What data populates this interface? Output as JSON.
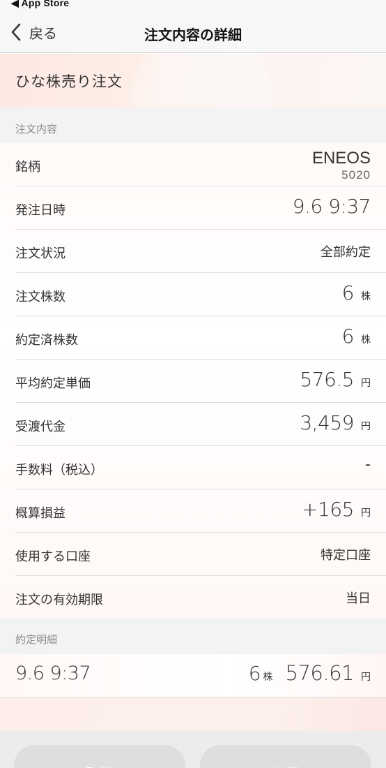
{
  "status_bar": {
    "back_label": "◀ App Store"
  },
  "nav": {
    "back_label": "戻る",
    "title": "注文内容の詳細"
  },
  "order_type": "ひな株売り注文",
  "sections": {
    "order_details": "注文内容",
    "executions": "約定明細"
  },
  "details": {
    "stock": {
      "label": "銘柄",
      "name": "ENEOS",
      "code": "5020"
    },
    "order_time": {
      "label": "発注日時",
      "value": "9.6 9:37"
    },
    "status": {
      "label": "注文状況",
      "value": "全部約定"
    },
    "quantity": {
      "label": "注文株数",
      "value": "6",
      "unit": "株"
    },
    "executed_quantity": {
      "label": "約定済株数",
      "value": "6",
      "unit": "株"
    },
    "avg_price": {
      "label": "平均約定単価",
      "value": "576.5",
      "unit": "円"
    },
    "settlement": {
      "label": "受渡代金",
      "value": "3,459",
      "unit": "円"
    },
    "fee": {
      "label": "手数料（税込）",
      "value": "-"
    },
    "profit": {
      "label": "概算損益",
      "value": "+165",
      "unit": "円"
    },
    "account": {
      "label": "使用する口座",
      "value": "特定口座"
    },
    "expiry": {
      "label": "注文の有効期限",
      "value": "当日"
    }
  },
  "executions": [
    {
      "time": "9.6 9:37",
      "quantity": "6",
      "quantity_unit": "株",
      "price": "576.61",
      "price_unit": "円"
    }
  ],
  "buttons": {
    "cancel": "取消",
    "modify": "訂正"
  },
  "colors": {
    "banner": "#fde8e2",
    "section_bg": "#f3f3f3",
    "button_disabled": "#dedede"
  }
}
